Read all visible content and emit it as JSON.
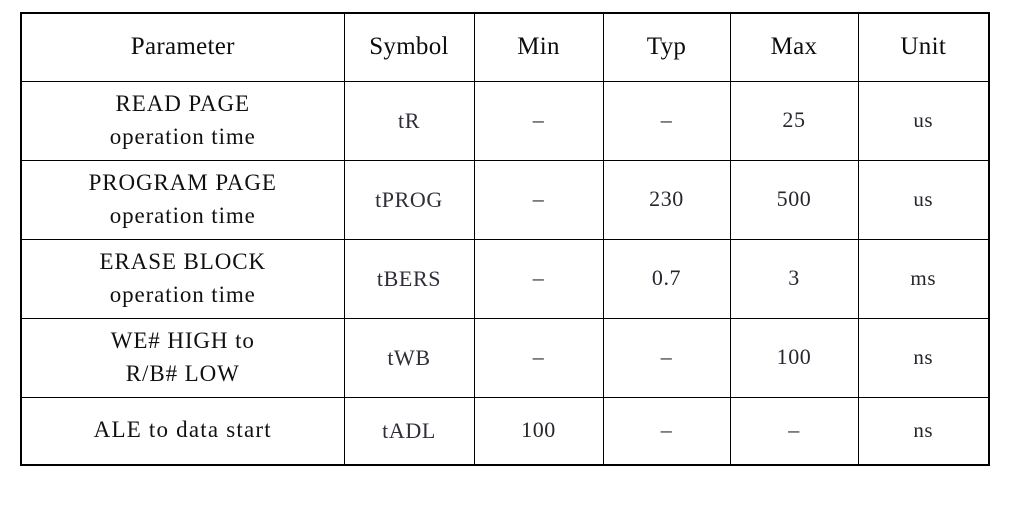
{
  "table": {
    "columns": [
      {
        "key": "parameter",
        "label": "Parameter"
      },
      {
        "key": "symbol",
        "label": "Symbol"
      },
      {
        "key": "min",
        "label": "Min"
      },
      {
        "key": "typ",
        "label": "Typ"
      },
      {
        "key": "max",
        "label": "Max"
      },
      {
        "key": "unit",
        "label": "Unit"
      }
    ],
    "rows": [
      {
        "parameter_line1": "READ PAGE",
        "parameter_line2": "operation time",
        "symbol": "tR",
        "min": "–",
        "typ": "–",
        "max": "25",
        "unit": "us"
      },
      {
        "parameter_line1": "PROGRAM PAGE",
        "parameter_line2": "operation time",
        "symbol": "tPROG",
        "min": "–",
        "typ": "230",
        "max": "500",
        "unit": "us"
      },
      {
        "parameter_line1": "ERASE BLOCK",
        "parameter_line2": "operation time",
        "symbol": "tBERS",
        "min": "–",
        "typ": "0.7",
        "max": "3",
        "unit": "ms"
      },
      {
        "parameter_line1": "WE# HIGH to",
        "parameter_line2": "R/B# LOW",
        "symbol": "tWB",
        "min": "–",
        "typ": "–",
        "max": "100",
        "unit": "ns"
      },
      {
        "parameter_line1": "ALE to data start",
        "parameter_line2": "",
        "symbol": "tADL",
        "min": "100",
        "typ": "–",
        "max": "–",
        "unit": "ns"
      }
    ]
  },
  "colors": {
    "border": "#000000",
    "background": "#ffffff",
    "header_text": "#0d0d0d",
    "parameter_text": "#101010",
    "symbol_text": "#2e2e38",
    "value_text": "#26262e"
  }
}
